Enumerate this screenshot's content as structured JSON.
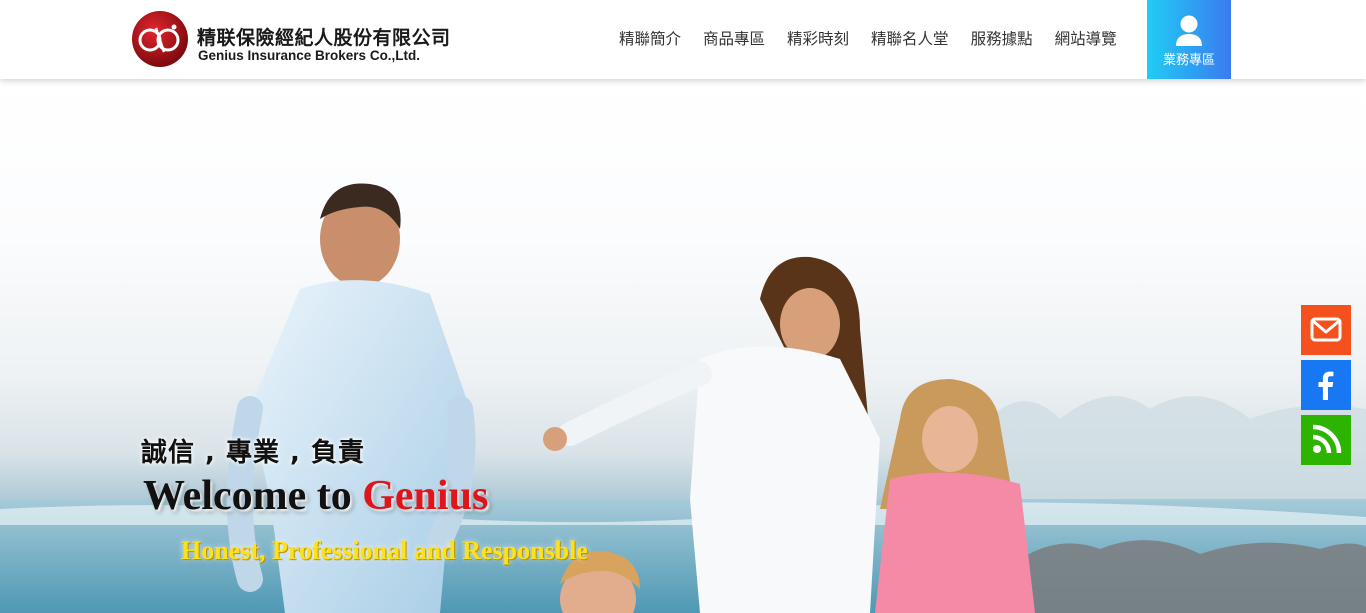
{
  "header": {
    "logo": {
      "monogram": "G&G",
      "name_cn": "精联保險經紀人股份有限公司",
      "name_en": "Genius Insurance Brokers Co.,Ltd."
    },
    "nav": [
      {
        "label": "精聯簡介"
      },
      {
        "label": "商品專區"
      },
      {
        "label": "精彩時刻"
      },
      {
        "label": "精聯名人堂"
      },
      {
        "label": "服務據點"
      },
      {
        "label": "網站導覽"
      }
    ],
    "member_button": {
      "label": "業務專區",
      "icon": "user-icon",
      "colors": [
        "#20cdf4",
        "#3a7bf0"
      ]
    }
  },
  "hero": {
    "slogan": "誠信 , 專業 , 負責",
    "welcome_prefix": "Welcome to ",
    "welcome_brand": "Genius",
    "tagline": "Honest, Professional and Responsble",
    "brand_color": "#e0141b",
    "tagline_color": "#ffe11a"
  },
  "side_bar": [
    {
      "name": "email",
      "icon": "envelope-icon",
      "color": "#f4511e"
    },
    {
      "name": "facebook",
      "icon": "facebook-icon",
      "color": "#1877f2"
    },
    {
      "name": "rss",
      "icon": "rss-icon",
      "color": "#2db400"
    }
  ]
}
